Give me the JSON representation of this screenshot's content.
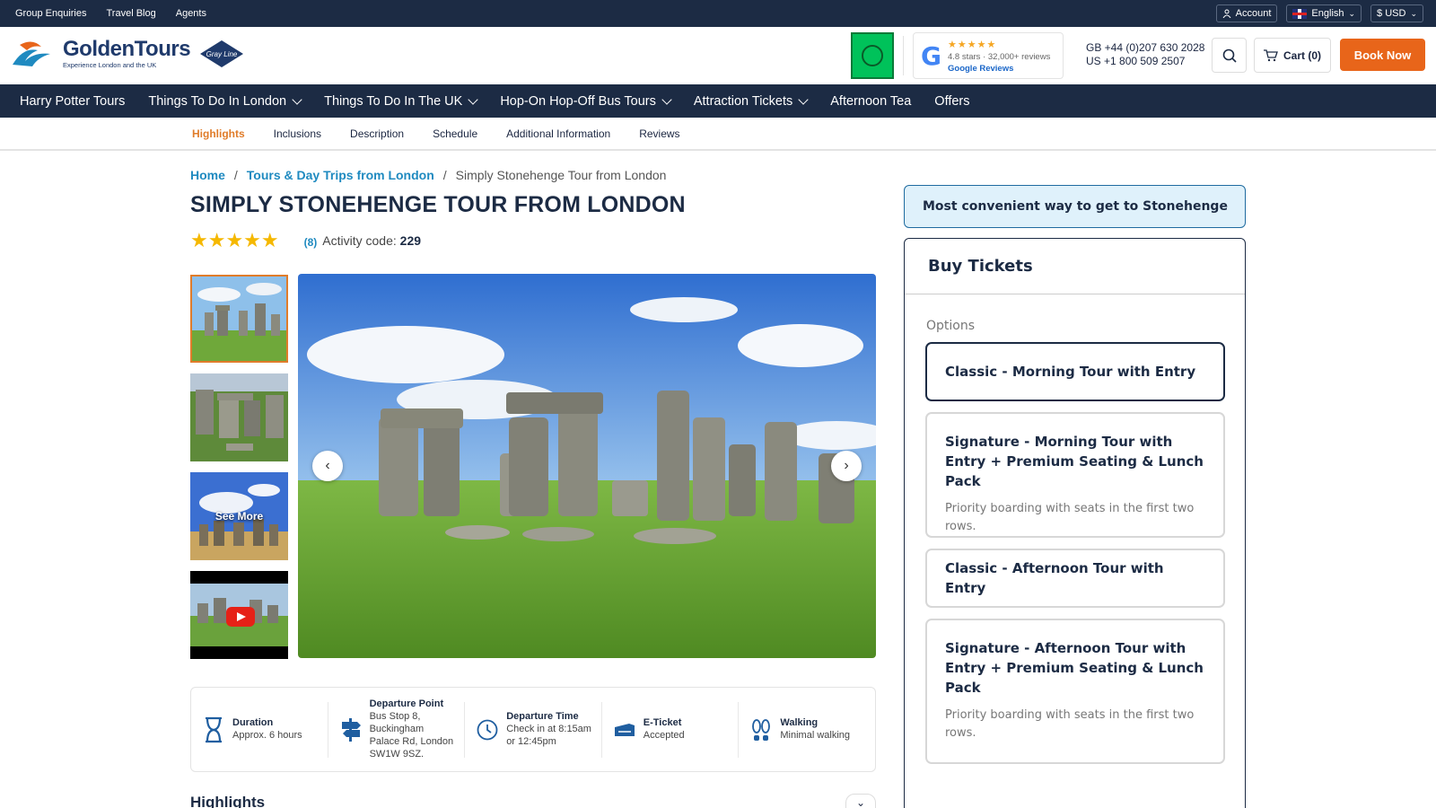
{
  "topbar": {
    "links": [
      "Group Enquiries",
      "Travel Blog",
      "Agents"
    ],
    "account": "Account",
    "language": "English",
    "currency": "$ USD"
  },
  "header": {
    "logo_name": "GoldenTours",
    "logo_tagline": "Experience London and the UK",
    "partner_logo": "Gray Line",
    "google": {
      "stars": "★★★★★",
      "rating_text": "4.8 stars · 32,000+ reviews",
      "link": "Google Reviews"
    },
    "phone_gb": "GB +44 (0)207 630 2028",
    "phone_us": "US +1 800 509 2507",
    "cart": "Cart (0)",
    "book_now": "Book Now"
  },
  "nav": [
    {
      "label": "Harry Potter Tours",
      "dropdown": false
    },
    {
      "label": "Things To Do In London",
      "dropdown": true
    },
    {
      "label": "Things To Do In The UK",
      "dropdown": true
    },
    {
      "label": "Hop-On Hop-Off Bus Tours",
      "dropdown": true
    },
    {
      "label": "Attraction Tickets",
      "dropdown": true
    },
    {
      "label": "Afternoon Tea",
      "dropdown": false
    },
    {
      "label": "Offers",
      "dropdown": false
    }
  ],
  "subtabs": [
    "Highlights",
    "Inclusions",
    "Description",
    "Schedule",
    "Additional Information",
    "Reviews"
  ],
  "breadcrumb": {
    "home": "Home",
    "category": "Tours & Day Trips from London",
    "current": "Simply Stonehenge Tour from London"
  },
  "product": {
    "title": "SIMPLY STONEHENGE TOUR FROM LONDON",
    "stars": "★★★★★",
    "review_count": "(8)",
    "activity_label": "Activity code:",
    "activity_code": "229",
    "see_more": "See More"
  },
  "info": [
    {
      "icon": "hourglass-icon",
      "title": "Duration",
      "value": "Approx. 6 hours"
    },
    {
      "icon": "signpost-icon",
      "title": "Departure Point",
      "value": "Bus Stop 8, Buckingham Palace Rd, London SW1W 9SZ."
    },
    {
      "icon": "clock-icon",
      "title": "Departure Time",
      "value": "Check in at 8:15am or 12:45pm"
    },
    {
      "icon": "ticket-icon",
      "title": "E-Ticket",
      "value": "Accepted"
    },
    {
      "icon": "footprints-icon",
      "title": "Walking",
      "value": "Minimal walking"
    }
  ],
  "highlights_title": "Highlights",
  "sidebar": {
    "convenient": "Most convenient way to get to Stonehenge",
    "buy_title": "Buy Tickets",
    "options_label": "Options",
    "options": [
      {
        "name": "Classic - Morning Tour with Entry",
        "desc": ""
      },
      {
        "name": "Signature - Morning Tour with Entry + Premium Seating & Lunch Pack",
        "desc": "Priority boarding with seats in the first two rows."
      },
      {
        "name": "Classic - Afternoon Tour with Entry",
        "desc": ""
      },
      {
        "name": "Signature - Afternoon Tour with Entry + Premium Seating & Lunch Pack",
        "desc": "Priority boarding with seats in the first two rows."
      }
    ]
  }
}
